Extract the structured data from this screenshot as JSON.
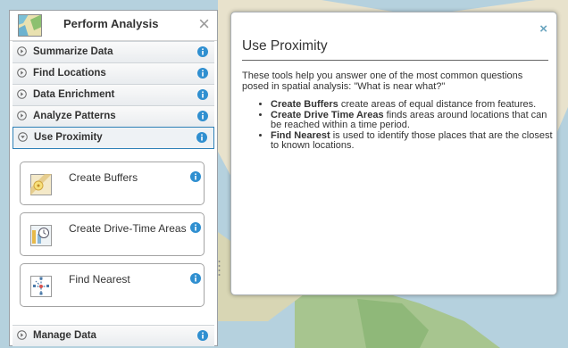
{
  "panel": {
    "title": "Perform Analysis",
    "close_glyph": "×",
    "sections_top": [
      {
        "label": "Summarize Data"
      },
      {
        "label": "Find Locations"
      },
      {
        "label": "Data Enrichment"
      },
      {
        "label": "Analyze Patterns"
      }
    ],
    "active_section": {
      "label": "Use Proximity"
    },
    "tools": [
      {
        "label": "Create Buffers",
        "icon": "create-buffers-icon"
      },
      {
        "label": "Create Drive-Time Areas",
        "icon": "drive-time-icon"
      },
      {
        "label": "Find Nearest",
        "icon": "find-nearest-icon"
      }
    ],
    "sections_bottom": [
      {
        "label": "Manage Data"
      }
    ]
  },
  "help_popup": {
    "title": "Use Proximity",
    "close_glyph": "×",
    "intro": "These tools help you answer one of the most common questions posed in spatial analysis: \"What is near what?\"",
    "items": [
      {
        "term": "Create Buffers",
        "text": " create areas of equal distance from features."
      },
      {
        "term": "Create Drive Time Areas",
        "text": " finds areas around locations that can be reached within a time period."
      },
      {
        "term": "Find Nearest",
        "text": " is used to identify those places that are the closest to known locations."
      }
    ]
  },
  "colors": {
    "info": "#2f8fd0",
    "active_border": "#2f81b7",
    "close_popup": "#6aa5bf"
  }
}
